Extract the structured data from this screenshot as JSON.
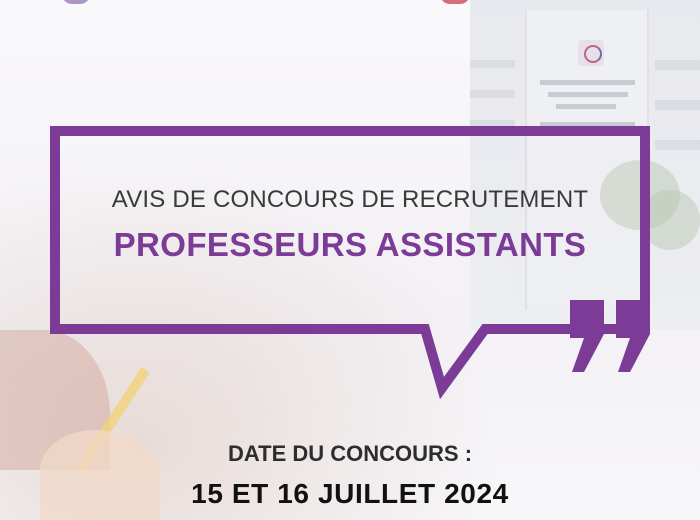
{
  "poster": {
    "heading": "AVIS DE CONCOURS DE RECRUTEMENT",
    "title": "PROFESSEURS ASSISTANTS",
    "date_label": "DATE DU CONCOURS :",
    "date_value": "15 ET 16 JUILLET 2024"
  },
  "colors": {
    "accent_purple": "#7b3b96",
    "text_dark": "#3a3a3a",
    "date_text": "#111111"
  },
  "icons": {
    "quote": "closing-quote-icon",
    "building_logo": "university-logo-icon"
  }
}
